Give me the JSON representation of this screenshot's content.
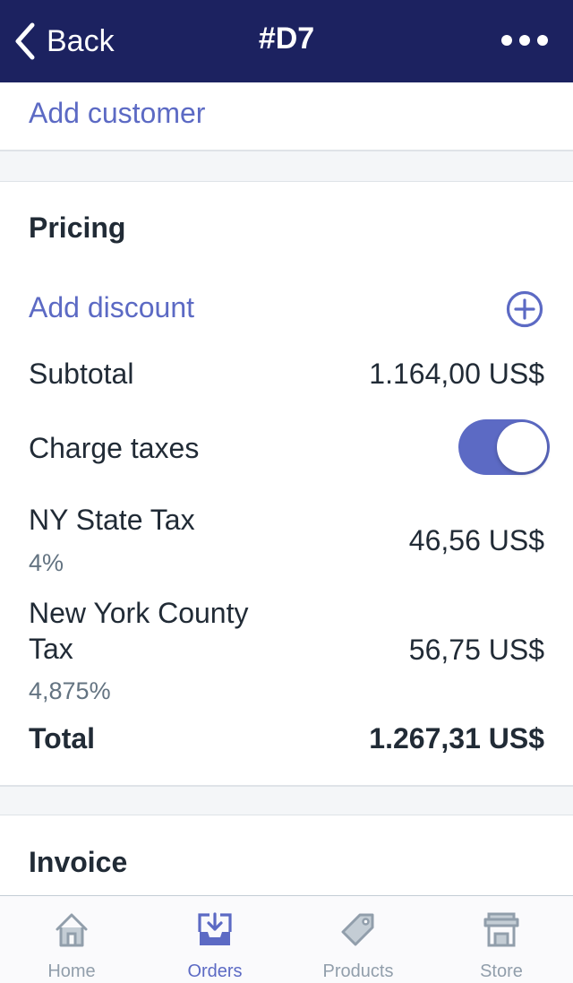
{
  "navbar": {
    "back_label": "Back",
    "title": "#D7"
  },
  "customer": {
    "add_customer_label": "Add customer"
  },
  "pricing": {
    "title": "Pricing",
    "add_discount_label": "Add discount",
    "subtotal_label": "Subtotal",
    "subtotal_value": "1.164,00 US$",
    "charge_taxes_label": "Charge taxes",
    "charge_taxes_enabled": true,
    "taxes": [
      {
        "name": "NY State Tax",
        "rate": "4%",
        "amount": "46,56 US$"
      },
      {
        "name": "New York County Tax",
        "rate": "4,875%",
        "amount": "56,75 US$"
      }
    ],
    "total_label": "Total",
    "total_value": "1.267,31 US$"
  },
  "invoice": {
    "title": "Invoice"
  },
  "tabbar": {
    "items": [
      {
        "label": "Home",
        "icon": "home-icon",
        "active": false
      },
      {
        "label": "Orders",
        "icon": "orders-icon",
        "active": true
      },
      {
        "label": "Products",
        "icon": "tag-icon",
        "active": false
      },
      {
        "label": "Store",
        "icon": "store-icon",
        "active": false
      }
    ]
  },
  "colors": {
    "nav_background": "#1c2260",
    "accent": "#5c6ac4",
    "text": "#212b36",
    "muted": "#637381",
    "inactive_tab": "#919eab"
  }
}
